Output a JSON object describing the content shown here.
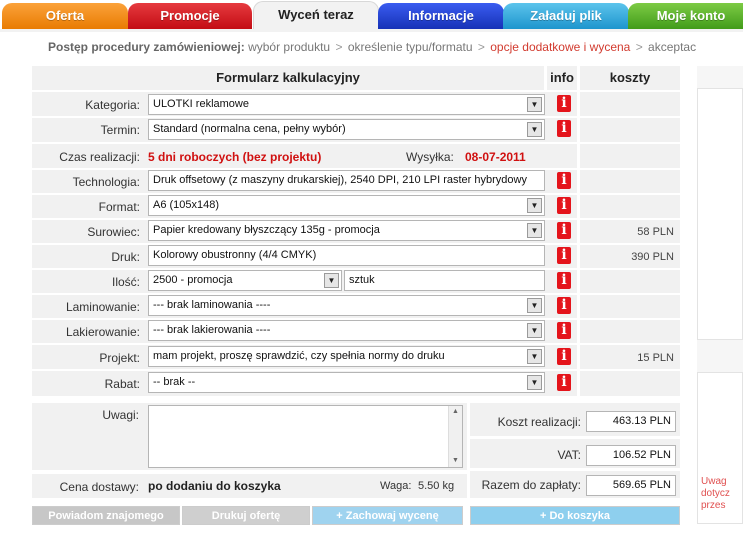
{
  "tabs": [
    {
      "label": "Oferta",
      "color": "#f58a10"
    },
    {
      "label": "Promocje",
      "color": "#d4181f"
    },
    {
      "label": "Wyceń teraz",
      "color": "#f2f2f2"
    },
    {
      "label": "Informacje",
      "color": "#1f3fc8"
    },
    {
      "label": "Załaduj plik",
      "color": "#2aa3d8"
    },
    {
      "label": "Moje konto",
      "color": "#58b12a"
    }
  ],
  "breadcrumb": {
    "label": "Postęp procedury zamówieniowej:",
    "steps": [
      "wybór produktu",
      "określenie typu/formatu",
      "opcje dodatkowe i wycena",
      "akceptac"
    ]
  },
  "form": {
    "title": "Formularz kalkulacyjny",
    "info_header": "info",
    "costs_header": "koszty",
    "info_glyph": "i",
    "kategoria": {
      "label": "Kategoria:",
      "value": "ULOTKI reklamowe"
    },
    "termin": {
      "label": "Termin:",
      "value": "Standard (normalna cena, pełny wybór)"
    },
    "czas": {
      "label": "Czas realizacji:",
      "value": "5 dni roboczych (bez projektu)",
      "ship_label": "Wysyłka:",
      "ship_date": "08-07-2011"
    },
    "technologia": {
      "label": "Technologia:",
      "value": "Druk offsetowy (z maszyny drukarskiej), 2540 DPI, 210 LPI raster hybrydowy"
    },
    "format": {
      "label": "Format:",
      "value": "A6 (105x148)"
    },
    "surowiec": {
      "label": "Surowiec:",
      "value": "Papier kredowany błyszczący 135g - promocja",
      "cost": "58 PLN"
    },
    "druk": {
      "label": "Druk:",
      "value": "Kolorowy obustronny (4/4 CMYK)",
      "cost": "390 PLN"
    },
    "ilosc": {
      "label": "Ilość:",
      "value": "2500 - promocja",
      "unit": "sztuk"
    },
    "laminowanie": {
      "label": "Laminowanie:",
      "value": "--- brak laminowania ----"
    },
    "lakierowanie": {
      "label": "Lakierowanie:",
      "value": "--- brak lakierowania ----"
    },
    "projekt": {
      "label": "Projekt:",
      "value": "mam projekt, proszę sprawdzić, czy spełnia normy do druku",
      "cost": "15 PLN"
    },
    "rabat": {
      "label": "Rabat:",
      "value": "-- brak --"
    },
    "uwagi": {
      "label": "Uwagi:"
    },
    "delivery": {
      "label": "Cena dostawy:",
      "value": "po dodaniu do koszyka",
      "weight_label": "Waga:",
      "weight": "5.50 kg"
    }
  },
  "summary": {
    "koszt": {
      "label": "Koszt realizacji:",
      "value": "463.13 PLN"
    },
    "vat": {
      "label": "VAT:",
      "value": "106.52 PLN"
    },
    "razem": {
      "label": "Razem do zapłaty:",
      "value": "569.65 PLN"
    }
  },
  "buttons": {
    "recommend": "Powiadom znajomego",
    "print": "Drukuj ofertę",
    "save": "+ Zachowaj wycenę",
    "cart": "+ Do koszyka"
  },
  "right_panel": {
    "text": "Uwag dotycz przes"
  }
}
